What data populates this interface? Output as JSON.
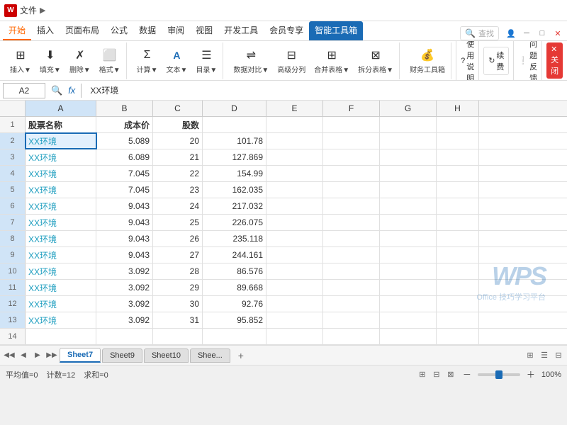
{
  "titleBar": {
    "icon": "W",
    "filename": "文件",
    "tabs": [
      "开始",
      "插入",
      "页面布局",
      "公式",
      "数据",
      "审阅",
      "视图",
      "开发工具",
      "会员专享",
      "智能工具箱"
    ],
    "searchPlaceholder": "查找",
    "windowBtns": [
      "─",
      "□",
      "✕"
    ]
  },
  "toolbar": {
    "groups": [
      {
        "name": "insert-group",
        "buttons": [
          {
            "label": "插入▼",
            "icon": "⊞"
          },
          {
            "label": "填充▼",
            "icon": "⬇"
          },
          {
            "label": "删除▼",
            "icon": "✗"
          },
          {
            "label": "格式▼",
            "icon": "⬜"
          }
        ]
      },
      {
        "name": "calc-group",
        "buttons": [
          {
            "label": "计算▼",
            "icon": "Σ"
          },
          {
            "label": "文本▼",
            "icon": "A"
          },
          {
            "label": "目录▼",
            "icon": "☰"
          }
        ]
      },
      {
        "name": "data-group",
        "buttons": [
          {
            "label": "数据对比▼",
            "icon": "⇌"
          },
          {
            "label": "高级分列",
            "icon": "⊟"
          },
          {
            "label": "合并表格▼",
            "icon": "⊞"
          },
          {
            "label": "拆分表格▼",
            "icon": "⊠"
          }
        ]
      },
      {
        "name": "finance-group",
        "buttons": [
          {
            "label": "财务工具箱",
            "icon": "💰"
          }
        ]
      }
    ],
    "rightButtons": [
      {
        "label": "使用说明",
        "icon": "?"
      },
      {
        "label": "续费",
        "icon": "↻"
      },
      {
        "label": "问题反馈",
        "icon": "!"
      },
      {
        "label": "关闭",
        "icon": "✕"
      }
    ]
  },
  "formulaBar": {
    "cellRef": "A2",
    "formula": "XX环境"
  },
  "columns": {
    "headers": [
      "A",
      "B",
      "C",
      "D",
      "E",
      "F",
      "G",
      "H"
    ],
    "widths": [
      100,
      80,
      70,
      90,
      80,
      80,
      80,
      60
    ]
  },
  "rows": [
    {
      "rowNum": 1,
      "cells": [
        "股票名称",
        "成本价",
        "股数",
        "",
        "",
        "",
        "",
        ""
      ]
    },
    {
      "rowNum": 2,
      "cells": [
        "XX环境",
        "5.089",
        "20",
        "101.78",
        "",
        "",
        "",
        ""
      ]
    },
    {
      "rowNum": 3,
      "cells": [
        "XX环境",
        "6.089",
        "21",
        "127.869",
        "",
        "",
        "",
        ""
      ]
    },
    {
      "rowNum": 4,
      "cells": [
        "XX环境",
        "7.045",
        "22",
        "154.99",
        "",
        "",
        "",
        ""
      ]
    },
    {
      "rowNum": 5,
      "cells": [
        "XX环境",
        "7.045",
        "23",
        "162.035",
        "",
        "",
        "",
        ""
      ]
    },
    {
      "rowNum": 6,
      "cells": [
        "XX环境",
        "9.043",
        "24",
        "217.032",
        "",
        "",
        "",
        ""
      ]
    },
    {
      "rowNum": 7,
      "cells": [
        "XX环境",
        "9.043",
        "25",
        "226.075",
        "",
        "",
        "",
        ""
      ]
    },
    {
      "rowNum": 8,
      "cells": [
        "XX环境",
        "9.043",
        "26",
        "235.118",
        "",
        "",
        "",
        ""
      ]
    },
    {
      "rowNum": 9,
      "cells": [
        "XX环境",
        "9.043",
        "27",
        "244.161",
        "",
        "",
        "",
        ""
      ]
    },
    {
      "rowNum": 10,
      "cells": [
        "XX环境",
        "3.092",
        "28",
        "86.576",
        "",
        "",
        "",
        ""
      ]
    },
    {
      "rowNum": 11,
      "cells": [
        "XX环境",
        "3.092",
        "29",
        "89.668",
        "",
        "",
        "",
        ""
      ]
    },
    {
      "rowNum": 12,
      "cells": [
        "XX环境",
        "3.092",
        "30",
        "92.76",
        "",
        "",
        "",
        ""
      ]
    },
    {
      "rowNum": 13,
      "cells": [
        "XX环境",
        "3.092",
        "31",
        "95.852",
        "",
        "",
        "",
        ""
      ]
    },
    {
      "rowNum": 14,
      "cells": [
        "",
        "",
        "",
        "",
        "",
        "",
        "",
        ""
      ]
    }
  ],
  "selectedCell": "A2",
  "sheetTabs": {
    "tabs": [
      "Sheet7",
      "Sheet9",
      "Sheet10",
      "Shee..."
    ],
    "activeTab": "Sheet7"
  },
  "statusBar": {
    "avg": "平均值=0",
    "count": "计数=12",
    "sum": "求和=0",
    "zoom": "100%",
    "viewBtns": [
      "⊞",
      "⊟",
      "⊠"
    ]
  },
  "watermark": {
    "logo": "WPS",
    "subtitle": "Office 技巧学习平台"
  }
}
